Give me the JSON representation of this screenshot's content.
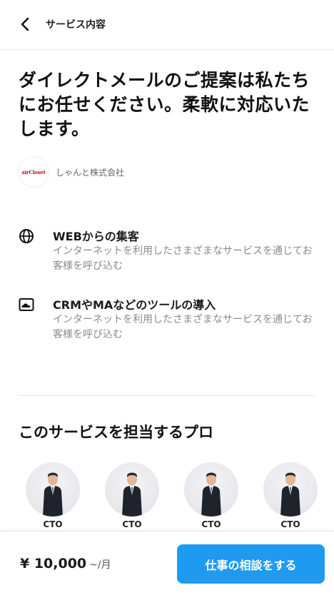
{
  "header": {
    "title": "サービス内容",
    "back_icon": "chevron-left-icon"
  },
  "service": {
    "title": "ダイレクトメールのご提案は私たちにお任せください。柔軟に対応いたします。"
  },
  "company": {
    "logo_text": "airCloset",
    "name": "しゃんと株式会社"
  },
  "features": [
    {
      "icon": "globe-icon",
      "title": "WEBからの集客",
      "description": "インターネットを利用したさまざまなサービスを通じてお客様を呼び込む"
    },
    {
      "icon": "cloud-icon",
      "title": "CRMやMAなどのツールの導入",
      "description": "インターネットを利用したさまざまなサービスを通じてお客様を呼び込む"
    }
  ],
  "pros_section": {
    "title": "このサービスを担当するプロ",
    "pros": [
      {
        "role": "CTO"
      },
      {
        "role": "CTO"
      },
      {
        "role": "CTO"
      },
      {
        "role": "CTO"
      }
    ]
  },
  "footer": {
    "price": "¥ 10,000",
    "price_unit": "~/月",
    "cta_label": "仕事の相談をする"
  },
  "colors": {
    "accent": "#1e9bf0",
    "logo_red": "#c8102e"
  }
}
